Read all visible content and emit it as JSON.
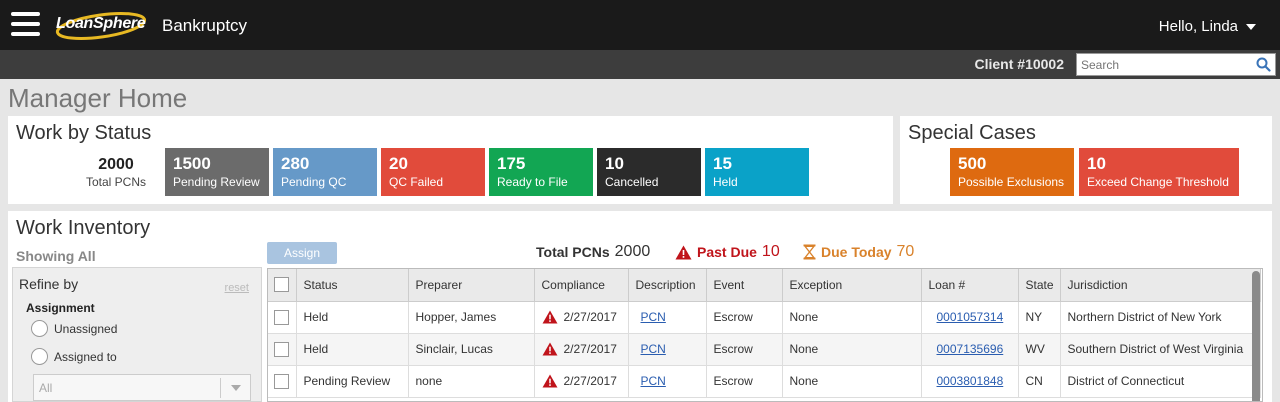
{
  "header": {
    "app_name": "LoanSphere",
    "app_title": "Bankruptcy",
    "greeting": "Hello, Linda"
  },
  "subheader": {
    "client": "Client #10002",
    "search_placeholder": "Search"
  },
  "page": {
    "title": "Manager Home"
  },
  "work_by_status": {
    "title": "Work by Status",
    "total_value": "2000",
    "total_label": "Total PCNs",
    "tiles": [
      {
        "value": "1500",
        "label": "Pending Review",
        "color": "#6b6b6b"
      },
      {
        "value": "280",
        "label": "Pending QC",
        "color": "#6699c8"
      },
      {
        "value": "20",
        "label": "QC Failed",
        "color": "#e14b3b"
      },
      {
        "value": "175",
        "label": "Ready to File",
        "color": "#12a653"
      },
      {
        "value": "10",
        "label": "Cancelled",
        "color": "#2b2b2b"
      },
      {
        "value": "15",
        "label": "Held",
        "color": "#0aa2c8"
      }
    ]
  },
  "special_cases": {
    "title": "Special Cases",
    "tiles": [
      {
        "value": "500",
        "label": "Possible Exclusions",
        "color": "#de6a10"
      },
      {
        "value": "10",
        "label": "Exceed Change Threshold",
        "color": "#e14b3b"
      }
    ]
  },
  "work_inventory": {
    "title": "Work Inventory",
    "showing": "Showing All",
    "assign_button": "Assign",
    "summary": {
      "total_label": "Total PCNs",
      "total_value": "2000",
      "past_due_label": "Past Due",
      "past_due_value": "10",
      "due_today_label": "Due Today",
      "due_today_value": "70"
    },
    "refine": {
      "title": "Refine by",
      "reset": "reset",
      "assignment_label": "Assignment",
      "options": [
        "Unassigned",
        "Assigned to"
      ],
      "select_value": "All"
    },
    "columns": [
      "Status",
      "Preparer",
      "Compliance",
      "Description",
      "Event",
      "Exception",
      "Loan #",
      "State",
      "Jurisdiction"
    ],
    "rows": [
      {
        "status": "Held",
        "preparer": "Hopper, James",
        "compliance": "2/27/2017",
        "description": "PCN",
        "event": "Escrow",
        "exception": "None",
        "loan": "0001057314",
        "state": "NY",
        "jurisdiction": "Northern District of New York"
      },
      {
        "status": "Held",
        "preparer": "Sinclair, Lucas",
        "compliance": "2/27/2017",
        "description": "PCN",
        "event": "Escrow",
        "exception": "None",
        "loan": "0007135696",
        "state": "WV",
        "jurisdiction": "Southern District of West Virginia"
      },
      {
        "status": "Pending Review",
        "preparer": "none",
        "compliance": "2/27/2017",
        "description": "PCN",
        "event": "Escrow",
        "exception": "None",
        "loan": "0003801848",
        "state": "CN",
        "jurisdiction": "District of Connecticut"
      }
    ]
  },
  "colors": {
    "past_due": "#c0141b",
    "due_today": "#d9822b",
    "link": "#2a5db0",
    "topbar": "#1a1a1a"
  }
}
